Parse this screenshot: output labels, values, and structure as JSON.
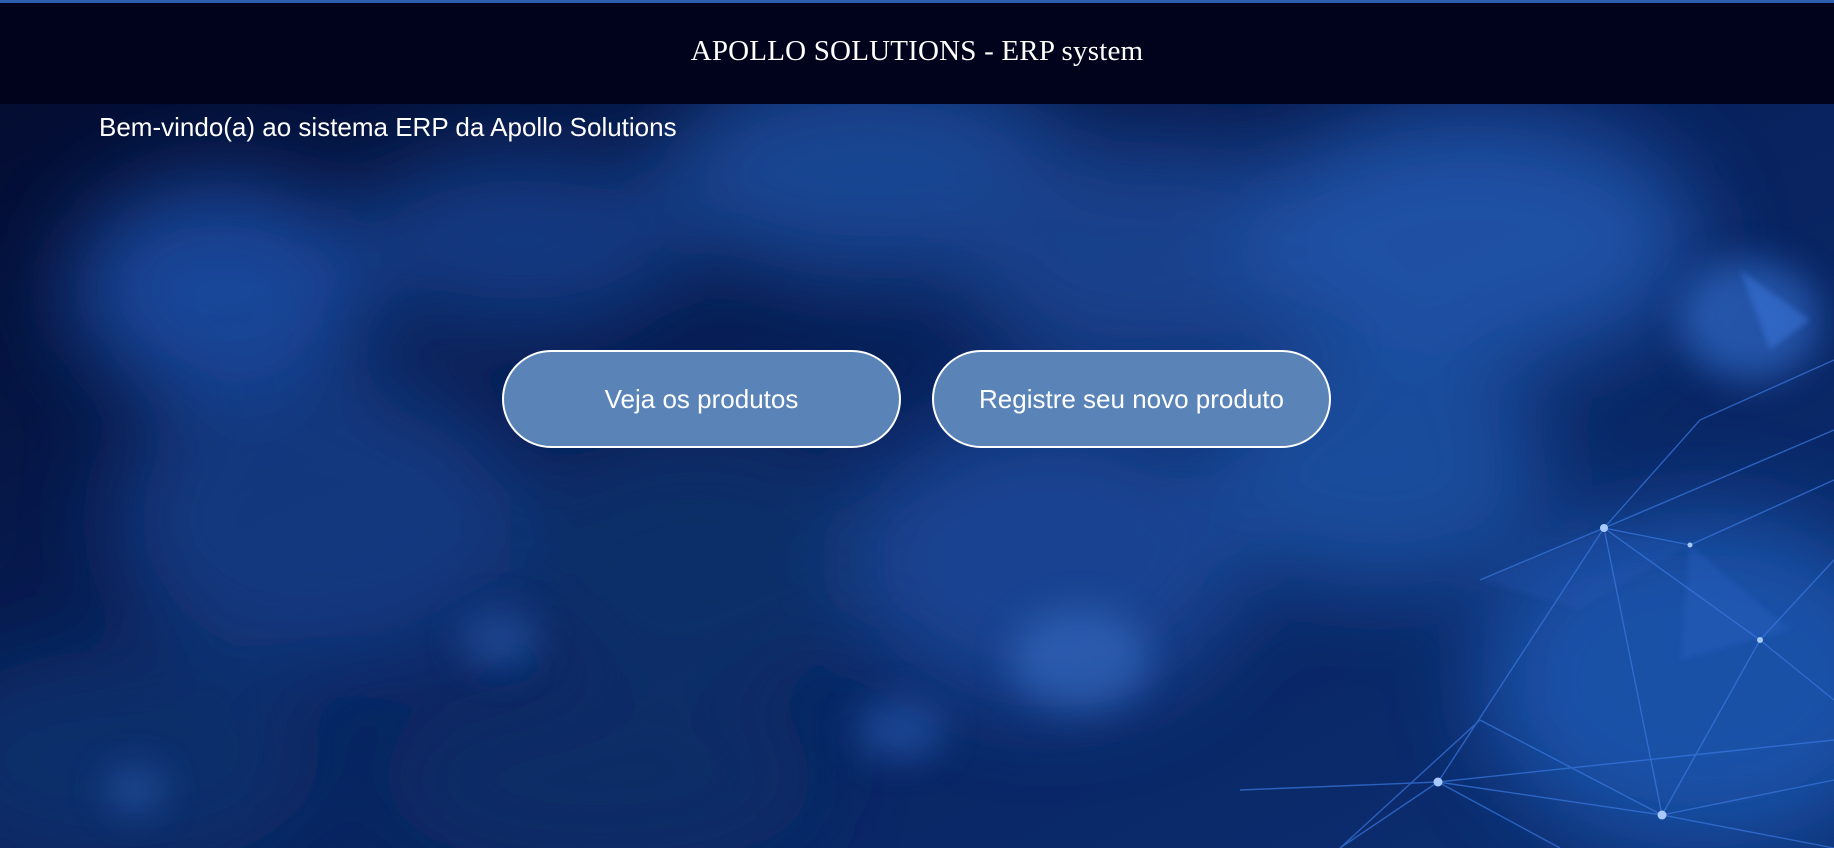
{
  "header": {
    "title": "APOLLO SOLUTIONS - ERP system"
  },
  "main": {
    "welcome_text": "Bem-vindo(a) ao sistema ERP da Apollo Solutions",
    "buttons": {
      "view_products_label": "Veja os produtos",
      "register_product_label": "Registre seu novo produto"
    }
  },
  "colors": {
    "header_bg": "#01031c",
    "accent_line": "#2f5fae",
    "button_fill": "#5a84b8",
    "button_border": "#ffffff",
    "page_bg": "#040a2a"
  },
  "background_image": "blue-network-abstract"
}
